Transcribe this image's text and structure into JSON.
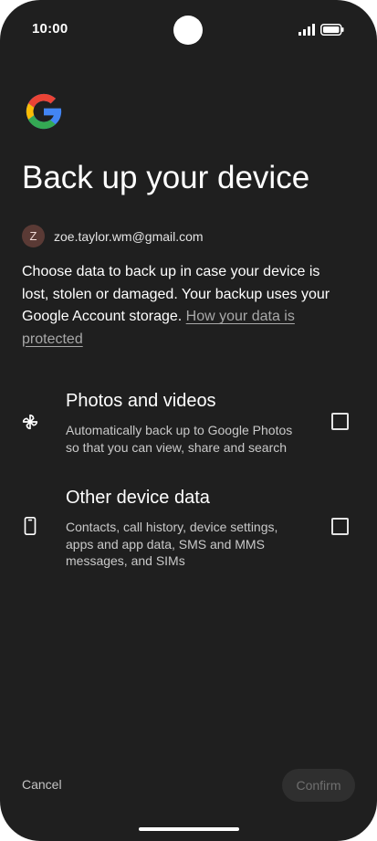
{
  "status_bar": {
    "time": "10:00",
    "icons": [
      "signal-icon",
      "battery-icon"
    ]
  },
  "header": {
    "logo": "google-g-logo",
    "title": "Back up your device"
  },
  "account": {
    "avatar_initial": "Z",
    "email": "zoe.taylor.wm@gmail.com"
  },
  "description": {
    "text": "Choose data to back up in case your device is lost, stolen or damaged. Your backup uses your Google Account storage. ",
    "link": "How your data is protected"
  },
  "options": [
    {
      "icon": "pinwheel-icon",
      "title": "Photos and videos",
      "description": "Automatically back up to Google Photos so that you can view, share and search",
      "checked": false
    },
    {
      "icon": "phone-icon",
      "title": "Other device data",
      "description": "Contacts, call history, device settings, apps and app data, SMS and MMS messages, and SIMs",
      "checked": false
    }
  ],
  "footer": {
    "cancel_label": "Cancel",
    "confirm_label": "Confirm"
  },
  "colors": {
    "background": "#1f1f1f",
    "text_primary": "#ffffff",
    "text_secondary": "#c9c9c9",
    "link": "#a8a8a8",
    "confirm_disabled_bg": "#2f2f2f",
    "confirm_disabled_text": "#6f6f6f"
  }
}
